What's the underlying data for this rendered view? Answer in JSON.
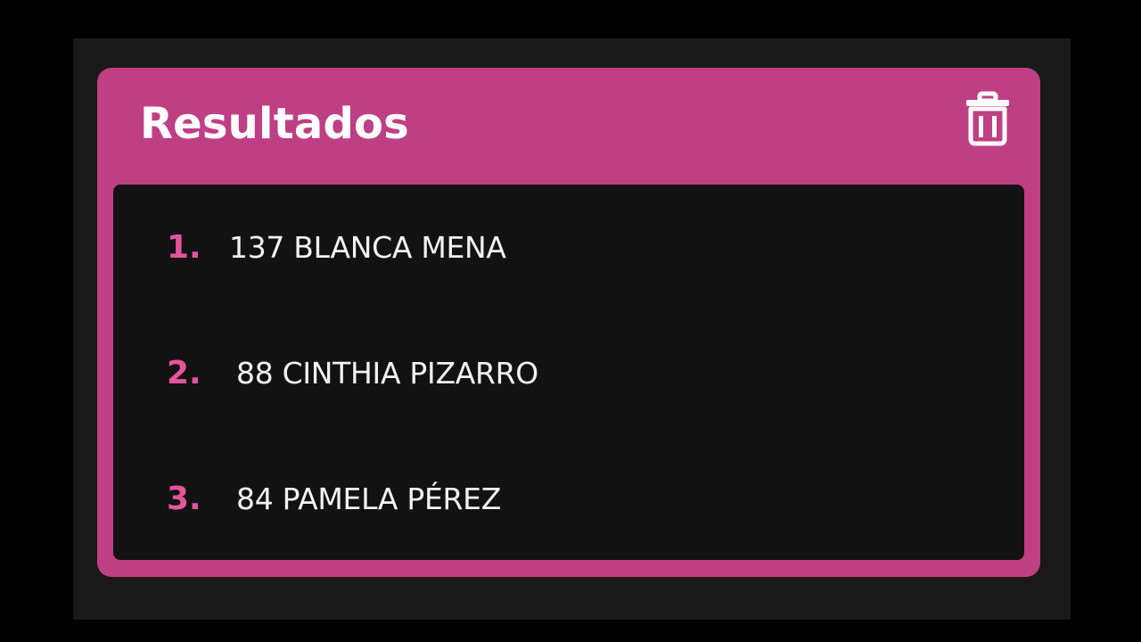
{
  "panel": {
    "title": "Resultados",
    "clear_icon": "trash-icon",
    "accent_color": "#bf3f84",
    "rank_color": "#e8549c"
  },
  "results": [
    {
      "rank": "1.",
      "text": "137 BLANCA MENA"
    },
    {
      "rank": "2.",
      "text": "88 CINTHIA PIZARRO"
    },
    {
      "rank": "3.",
      "text": "84 PAMELA PÉREZ"
    }
  ]
}
